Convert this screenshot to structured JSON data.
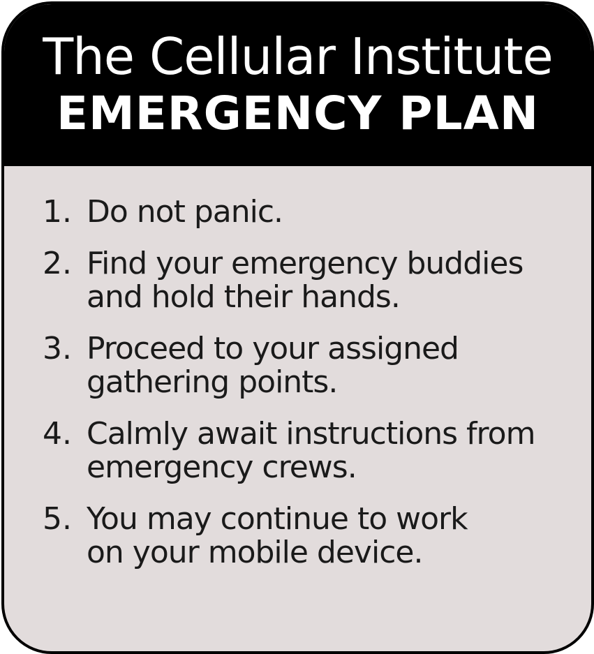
{
  "header": {
    "line1": "The Cellular Institute",
    "line2": "EMERGENCY PLAN"
  },
  "steps": [
    {
      "number": "1.",
      "lines": [
        "Do not panic."
      ]
    },
    {
      "number": "2.",
      "lines": [
        "Find your emergency buddies",
        "and hold their hands."
      ]
    },
    {
      "number": "3.",
      "lines": [
        "Proceed to your assigned",
        "gathering points."
      ]
    },
    {
      "number": "4.",
      "lines": [
        "Calmly await instructions from",
        "emergency crews."
      ]
    },
    {
      "number": "5.",
      "lines": [
        "You may continue to work",
        "on your mobile device."
      ]
    }
  ],
  "colors": {
    "header_bg": "#000000",
    "header_text": "#ffffff",
    "body_bg": "#e2dcdc",
    "body_text": "#1a1a1a",
    "border": "#000000"
  }
}
